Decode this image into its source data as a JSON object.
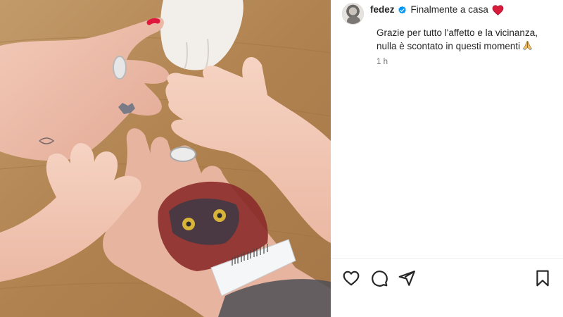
{
  "post": {
    "image_alt": "",
    "author": {
      "username": "fedez",
      "verified": true
    },
    "caption": {
      "title": "Finalmente a casa",
      "title_emoji": "red-heart-icon",
      "lines": [
        "Grazie per tutto l'affetto e la vicinanza,",
        "nulla è scontato in questi momenti"
      ],
      "end_emoji": "praying-hands-icon"
    },
    "timestamp": "1 h",
    "actions": [
      "like-icon",
      "comment-icon",
      "share-icon",
      "save-icon"
    ]
  },
  "colors": {
    "text": "#262626",
    "secondary": "#737373",
    "verified_blue": "#0095f6",
    "heart_red": "#e0245e"
  }
}
